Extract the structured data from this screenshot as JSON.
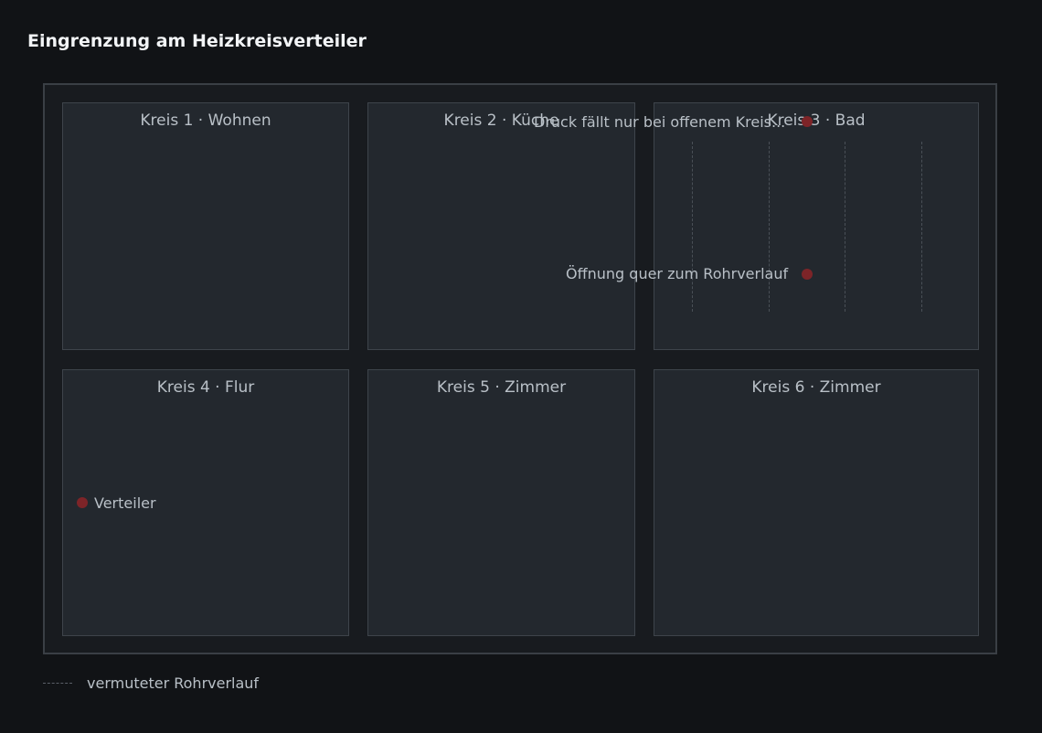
{
  "title": "Eingrenzung am Heizkreisverteiler",
  "circuits": [
    {
      "label": "Kreis 1 · Wohnen"
    },
    {
      "label": "Kreis 2 · Küche"
    },
    {
      "label": "Kreis 3 · Bad"
    },
    {
      "label": "Kreis 4 · Flur"
    },
    {
      "label": "Kreis 5 · Zimmer"
    },
    {
      "label": "Kreis 6 · Zimmer"
    }
  ],
  "markers": [
    {
      "label": "Druck fällt nur bei offenem Kreis..."
    },
    {
      "label": "Öffnung quer zum Rohrverlauf"
    },
    {
      "label": "Verteiler"
    }
  ],
  "legend": {
    "pipe_label": "vermuteter Rohrverlauf"
  },
  "colors": {
    "background": "#111316",
    "zone": "#23282e",
    "marker": "#7d2428",
    "text": "#b9c0c7"
  }
}
